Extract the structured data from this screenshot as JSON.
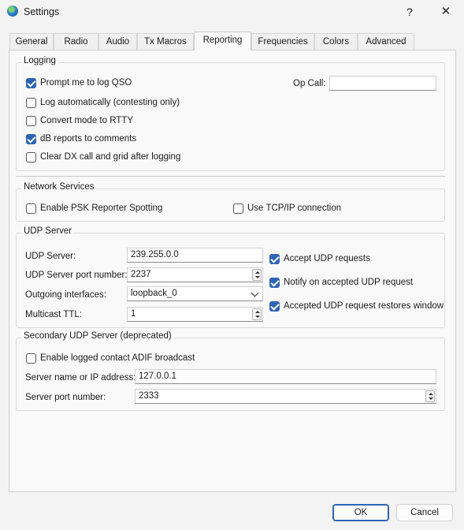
{
  "window": {
    "title": "Settings",
    "help_glyph": "?",
    "close_glyph": "✕"
  },
  "tabs": [
    "General",
    "Radio",
    "Audio",
    "Tx Macros",
    "Reporting",
    "Frequencies",
    "Colors",
    "Advanced"
  ],
  "active_tab": "Reporting",
  "logging": {
    "title": "Logging",
    "prompt_log": {
      "label": "Prompt me to log QSO",
      "checked": true
    },
    "log_auto": {
      "label": "Log automatically (contesting only)",
      "checked": false
    },
    "convert_rtty": {
      "label": "Convert mode to RTTY",
      "checked": false
    },
    "db_reports": {
      "label": "dB reports to comments",
      "checked": true
    },
    "clear_dx": {
      "label": "Clear DX call and grid after logging",
      "checked": false
    },
    "op_call_label": "Op Call:",
    "op_call_value": ""
  },
  "network": {
    "title": "Network Services",
    "psk": {
      "label": "Enable PSK Reporter Spotting",
      "checked": false
    },
    "tcpip": {
      "label": "Use TCP/IP connection",
      "checked": false
    }
  },
  "udp": {
    "title": "UDP Server",
    "server_label": "UDP Server:",
    "server_value": "239.255.0.0",
    "port_label": "UDP Server port number:",
    "port_value": "2237",
    "iface_label": "Outgoing interfaces:",
    "iface_value": "loopback_0",
    "ttl_label": "Multicast TTL:",
    "ttl_value": "1",
    "accept": {
      "label": "Accept UDP requests",
      "checked": true
    },
    "notify": {
      "label": "Notify on accepted UDP request",
      "checked": true
    },
    "restore": {
      "label": "Accepted UDP request restores window",
      "checked": true
    }
  },
  "secondary": {
    "title": "Secondary UDP Server (deprecated)",
    "adif": {
      "label": "Enable logged contact ADIF broadcast",
      "checked": false
    },
    "server_label": "Server name or IP address:",
    "server_value": "127.0.0.1",
    "port_label": "Server port number:",
    "port_value": "2333"
  },
  "buttons": {
    "ok": "OK",
    "cancel": "Cancel"
  }
}
